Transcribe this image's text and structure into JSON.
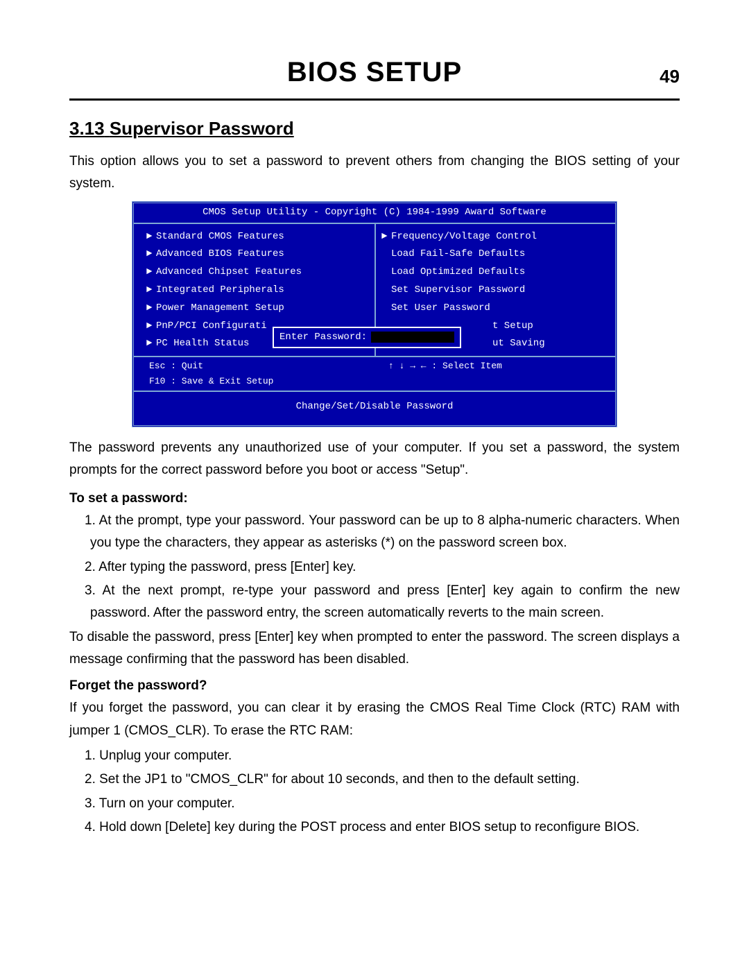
{
  "header": {
    "title": "BIOS SETUP",
    "page_number": "49"
  },
  "section": {
    "number": "3.13",
    "title": "Supervisor Password"
  },
  "intro": "This option allows you to set a password to prevent others from changing the BIOS setting of your system.",
  "bios": {
    "title": "CMOS Setup Utility - Copyright (C) 1984-1999 Award Software",
    "left_items": [
      "Standard CMOS Features",
      "Advanced BIOS Features",
      "Advanced Chipset Features",
      "Integrated Peripherals",
      "Power Management Setup",
      "PnP/PCI Configurati",
      "PC Health Status"
    ],
    "right_items": [
      {
        "arrow": true,
        "label": "Frequency/Voltage Control"
      },
      {
        "arrow": false,
        "label": "Load Fail-Safe Defaults"
      },
      {
        "arrow": false,
        "label": "Load Optimized Defaults"
      },
      {
        "arrow": false,
        "label": "Set Supervisor Password"
      },
      {
        "arrow": false,
        "label": "Set User Password"
      },
      {
        "arrow": false,
        "label": "t Setup"
      },
      {
        "arrow": false,
        "label": "ut Saving"
      }
    ],
    "password_prompt": "Enter Password:",
    "footer_left_1": "Esc : Quit",
    "footer_left_2": "F10 : Save & Exit Setup",
    "footer_right": "↑ ↓ → ←   : Select Item",
    "footer_bottom": "Change/Set/Disable Password"
  },
  "para2": "The password prevents any unauthorized use of your computer.  If you set a password, the system prompts for the correct password before you boot or access \"Setup\".",
  "set_pw_heading": "To set a password:",
  "set_steps": [
    "1. At the prompt, type your password.  Your password can be up to 8 alpha-numeric characters. When you type the characters, they appear as asterisks (*) on the password screen box.",
    "2. After typing the password, press [Enter] key.",
    "3. At the next prompt, re-type your password and press [Enter] key again to confirm the new password.  After the password entry, the screen automatically reverts to the main screen."
  ],
  "disable_para": "To disable the password, press [Enter] key when prompted to enter the password.  The screen displays a message confirming that the password has been disabled.",
  "forget_heading": "Forget the password?",
  "forget_para": "If you forget the password, you can clear it by erasing the CMOS Real Time Clock (RTC) RAM with jumper 1 (CMOS_CLR).  To erase the RTC RAM:",
  "forget_steps": [
    "1. Unplug your computer.",
    "2. Set the JP1 to \"CMOS_CLR\" for about 10 seconds, and then to the default setting.",
    "3. Turn on your computer.",
    "4. Hold down [Delete] key during the POST process and enter BIOS setup to reconfigure BIOS."
  ]
}
